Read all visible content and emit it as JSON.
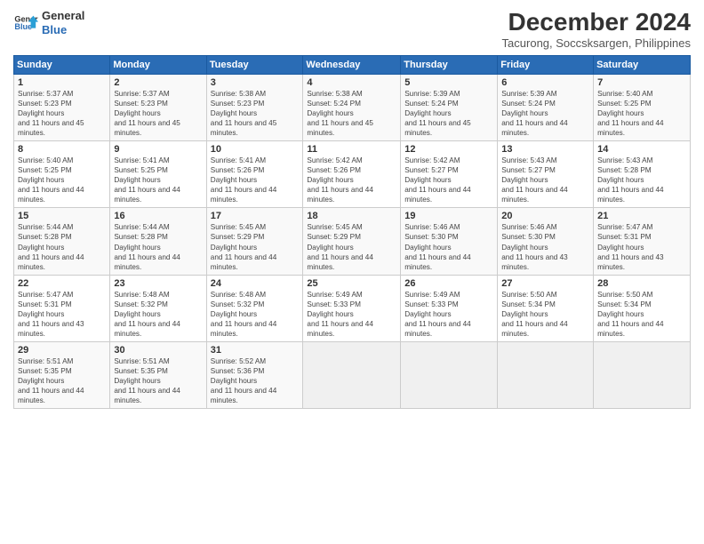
{
  "logo": {
    "line1": "General",
    "line2": "Blue"
  },
  "title": "December 2024",
  "location": "Tacurong, Soccsksargen, Philippines",
  "days_header": [
    "Sunday",
    "Monday",
    "Tuesday",
    "Wednesday",
    "Thursday",
    "Friday",
    "Saturday"
  ],
  "weeks": [
    [
      {
        "day": "1",
        "sunrise": "5:37 AM",
        "sunset": "5:23 PM",
        "daylight": "11 hours and 45 minutes."
      },
      {
        "day": "2",
        "sunrise": "5:37 AM",
        "sunset": "5:23 PM",
        "daylight": "11 hours and 45 minutes."
      },
      {
        "day": "3",
        "sunrise": "5:38 AM",
        "sunset": "5:23 PM",
        "daylight": "11 hours and 45 minutes."
      },
      {
        "day": "4",
        "sunrise": "5:38 AM",
        "sunset": "5:24 PM",
        "daylight": "11 hours and 45 minutes."
      },
      {
        "day": "5",
        "sunrise": "5:39 AM",
        "sunset": "5:24 PM",
        "daylight": "11 hours and 45 minutes."
      },
      {
        "day": "6",
        "sunrise": "5:39 AM",
        "sunset": "5:24 PM",
        "daylight": "11 hours and 44 minutes."
      },
      {
        "day": "7",
        "sunrise": "5:40 AM",
        "sunset": "5:25 PM",
        "daylight": "11 hours and 44 minutes."
      }
    ],
    [
      {
        "day": "8",
        "sunrise": "5:40 AM",
        "sunset": "5:25 PM",
        "daylight": "11 hours and 44 minutes."
      },
      {
        "day": "9",
        "sunrise": "5:41 AM",
        "sunset": "5:25 PM",
        "daylight": "11 hours and 44 minutes."
      },
      {
        "day": "10",
        "sunrise": "5:41 AM",
        "sunset": "5:26 PM",
        "daylight": "11 hours and 44 minutes."
      },
      {
        "day": "11",
        "sunrise": "5:42 AM",
        "sunset": "5:26 PM",
        "daylight": "11 hours and 44 minutes."
      },
      {
        "day": "12",
        "sunrise": "5:42 AM",
        "sunset": "5:27 PM",
        "daylight": "11 hours and 44 minutes."
      },
      {
        "day": "13",
        "sunrise": "5:43 AM",
        "sunset": "5:27 PM",
        "daylight": "11 hours and 44 minutes."
      },
      {
        "day": "14",
        "sunrise": "5:43 AM",
        "sunset": "5:28 PM",
        "daylight": "11 hours and 44 minutes."
      }
    ],
    [
      {
        "day": "15",
        "sunrise": "5:44 AM",
        "sunset": "5:28 PM",
        "daylight": "11 hours and 44 minutes."
      },
      {
        "day": "16",
        "sunrise": "5:44 AM",
        "sunset": "5:28 PM",
        "daylight": "11 hours and 44 minutes."
      },
      {
        "day": "17",
        "sunrise": "5:45 AM",
        "sunset": "5:29 PM",
        "daylight": "11 hours and 44 minutes."
      },
      {
        "day": "18",
        "sunrise": "5:45 AM",
        "sunset": "5:29 PM",
        "daylight": "11 hours and 44 minutes."
      },
      {
        "day": "19",
        "sunrise": "5:46 AM",
        "sunset": "5:30 PM",
        "daylight": "11 hours and 44 minutes."
      },
      {
        "day": "20",
        "sunrise": "5:46 AM",
        "sunset": "5:30 PM",
        "daylight": "11 hours and 43 minutes."
      },
      {
        "day": "21",
        "sunrise": "5:47 AM",
        "sunset": "5:31 PM",
        "daylight": "11 hours and 43 minutes."
      }
    ],
    [
      {
        "day": "22",
        "sunrise": "5:47 AM",
        "sunset": "5:31 PM",
        "daylight": "11 hours and 43 minutes."
      },
      {
        "day": "23",
        "sunrise": "5:48 AM",
        "sunset": "5:32 PM",
        "daylight": "11 hours and 44 minutes."
      },
      {
        "day": "24",
        "sunrise": "5:48 AM",
        "sunset": "5:32 PM",
        "daylight": "11 hours and 44 minutes."
      },
      {
        "day": "25",
        "sunrise": "5:49 AM",
        "sunset": "5:33 PM",
        "daylight": "11 hours and 44 minutes."
      },
      {
        "day": "26",
        "sunrise": "5:49 AM",
        "sunset": "5:33 PM",
        "daylight": "11 hours and 44 minutes."
      },
      {
        "day": "27",
        "sunrise": "5:50 AM",
        "sunset": "5:34 PM",
        "daylight": "11 hours and 44 minutes."
      },
      {
        "day": "28",
        "sunrise": "5:50 AM",
        "sunset": "5:34 PM",
        "daylight": "11 hours and 44 minutes."
      }
    ],
    [
      {
        "day": "29",
        "sunrise": "5:51 AM",
        "sunset": "5:35 PM",
        "daylight": "11 hours and 44 minutes."
      },
      {
        "day": "30",
        "sunrise": "5:51 AM",
        "sunset": "5:35 PM",
        "daylight": "11 hours and 44 minutes."
      },
      {
        "day": "31",
        "sunrise": "5:52 AM",
        "sunset": "5:36 PM",
        "daylight": "11 hours and 44 minutes."
      },
      null,
      null,
      null,
      null
    ]
  ]
}
